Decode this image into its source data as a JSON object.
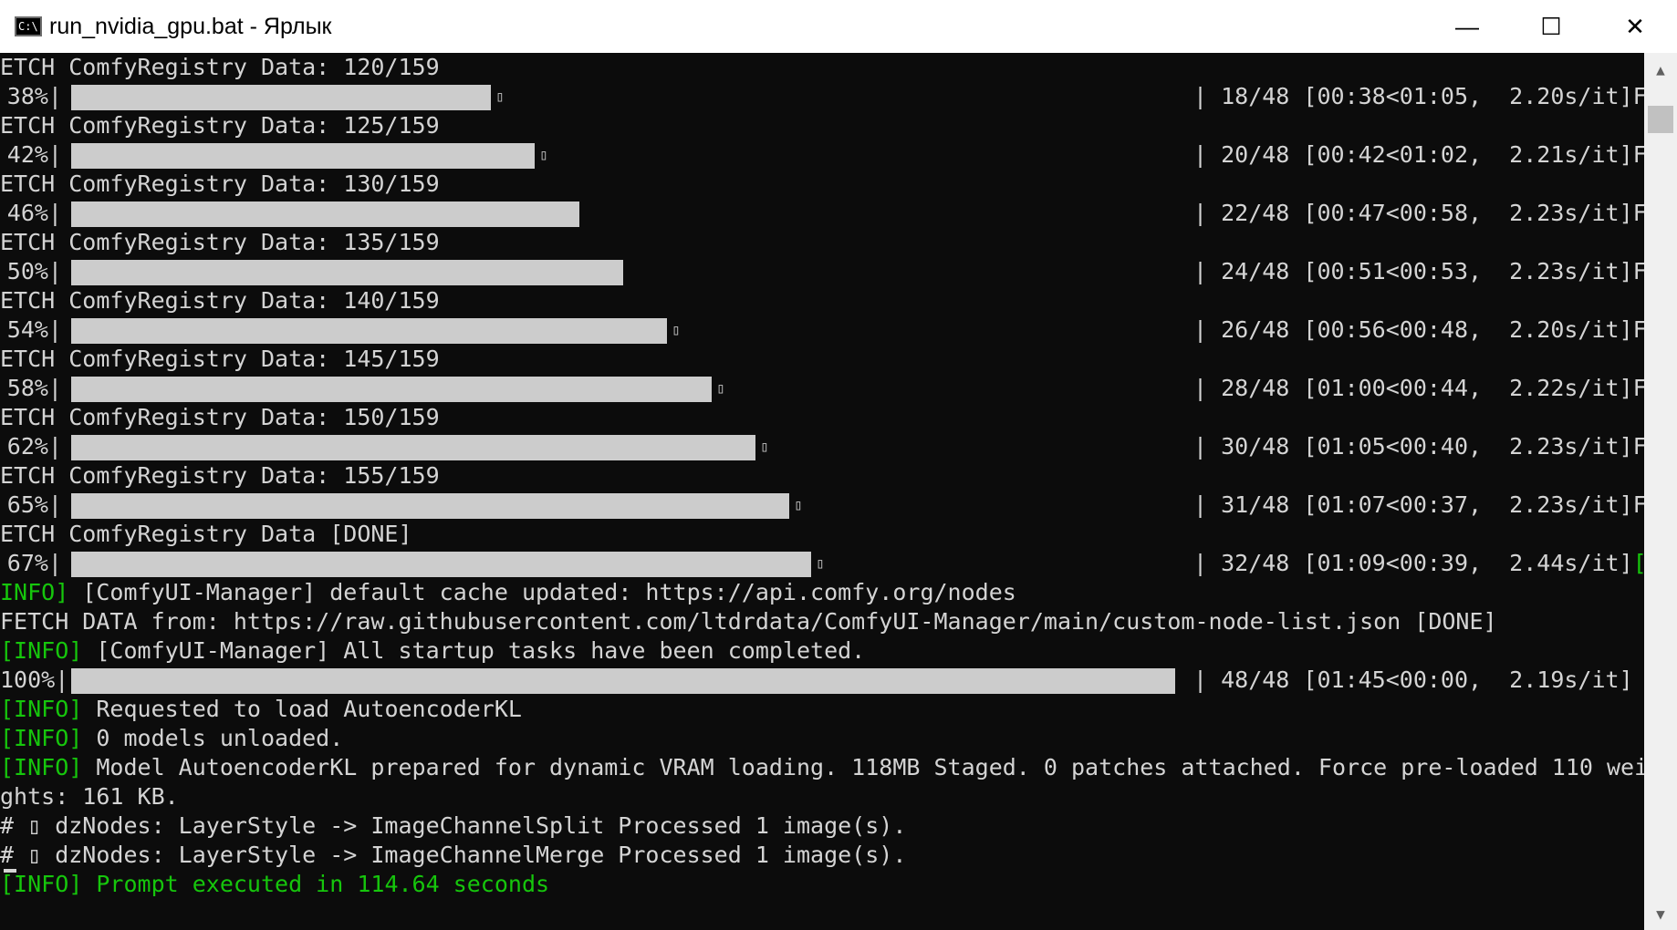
{
  "window": {
    "title": "run_nvidia_gpu.bat - Ярлык",
    "icon_name": "cmd-console-icon",
    "icon_label": "C:\\",
    "controls": {
      "minimize": "—",
      "maximize": "☐",
      "close": "✕"
    }
  },
  "console": {
    "colors": {
      "background": "#0c0c0c",
      "text": "#d4d4d4",
      "green": "#16c60c",
      "bar": "#cccccc"
    },
    "lines": [
      {
        "type": "text",
        "text": "ETCH ComfyRegistry Data: 120/159"
      },
      {
        "type": "bar",
        "percent_label": "38%|",
        "progress": 0.38,
        "glyph": "▯",
        "tail": "| 18/48 [00:38<01:05,  2.20s/it]F"
      },
      {
        "type": "text",
        "text": "ETCH ComfyRegistry Data: 125/159"
      },
      {
        "type": "bar",
        "percent_label": "42%|",
        "progress": 0.42,
        "glyph": "▯",
        "tail": "| 20/48 [00:42<01:02,  2.21s/it]F"
      },
      {
        "type": "text",
        "text": "ETCH ComfyRegistry Data: 130/159"
      },
      {
        "type": "bar",
        "percent_label": "46%|",
        "progress": 0.46,
        "glyph": "",
        "tail": "| 22/48 [00:47<00:58,  2.23s/it]F"
      },
      {
        "type": "text",
        "text": "ETCH ComfyRegistry Data: 135/159"
      },
      {
        "type": "bar",
        "percent_label": "50%|",
        "progress": 0.5,
        "glyph": "",
        "tail": "| 24/48 [00:51<00:53,  2.23s/it]F"
      },
      {
        "type": "text",
        "text": "ETCH ComfyRegistry Data: 140/159"
      },
      {
        "type": "bar",
        "percent_label": "54%|",
        "progress": 0.54,
        "glyph": "▯",
        "tail": "| 26/48 [00:56<00:48,  2.20s/it]F"
      },
      {
        "type": "text",
        "text": "ETCH ComfyRegistry Data: 145/159"
      },
      {
        "type": "bar",
        "percent_label": "58%|",
        "progress": 0.58,
        "glyph": "▯",
        "tail": "| 28/48 [01:00<00:44,  2.22s/it]F"
      },
      {
        "type": "text",
        "text": "ETCH ComfyRegistry Data: 150/159"
      },
      {
        "type": "bar",
        "percent_label": "62%|",
        "progress": 0.62,
        "glyph": "▯",
        "tail": "| 30/48 [01:05<00:40,  2.23s/it]F"
      },
      {
        "type": "text",
        "text": "ETCH ComfyRegistry Data: 155/159"
      },
      {
        "type": "bar",
        "percent_label": "65%|",
        "progress": 0.65,
        "glyph": "▯",
        "tail": "| 31/48 [01:07<00:37,  2.23s/it]F"
      },
      {
        "type": "text",
        "text": "ETCH ComfyRegistry Data [DONE]"
      },
      {
        "type": "bar",
        "percent_label": "67%|",
        "progress": 0.67,
        "glyph": "▯",
        "tail": "| 32/48 [01:09<00:39,  2.44s/it]",
        "tail_green": "["
      },
      {
        "type": "text",
        "prefix": "INFO]",
        "text": " [ComfyUI-Manager] default cache updated: https://api.comfy.org/nodes"
      },
      {
        "type": "text",
        "text": "FETCH DATA from: https://raw.githubusercontent.com/ltdrdata/ComfyUI-Manager/main/custom-node-list.json [DONE]"
      },
      {
        "type": "text",
        "prefix": "[INFO]",
        "text": " [ComfyUI-Manager] All startup tasks have been completed."
      },
      {
        "type": "bar",
        "percent_label": "100%|",
        "progress": 1.0,
        "glyph": "",
        "tail": "| 48/48 [01:45<00:00,  2.19s/it]"
      },
      {
        "type": "text",
        "prefix": "[INFO]",
        "text": " Requested to load AutoencoderKL"
      },
      {
        "type": "text",
        "prefix": "[INFO]",
        "text": " 0 models unloaded."
      },
      {
        "type": "text",
        "prefix": "[INFO]",
        "text": " Model AutoencoderKL prepared for dynamic VRAM loading. 118MB Staged. 0 patches attached. Force pre-loaded 110 wei"
      },
      {
        "type": "text",
        "text": "ghts: 161 KB."
      },
      {
        "type": "text",
        "text": "# ▯ dzNodes: LayerStyle -> ImageChannelSplit Processed 1 image(s)."
      },
      {
        "type": "text",
        "text": "# ▯ dzNodes: LayerStyle -> ImageChannelMerge Processed 1 image(s)."
      },
      {
        "type": "text",
        "prefix": "[INFO]",
        "text": " Prompt executed in 114.64 seconds",
        "all_green": true
      }
    ]
  },
  "scrollbar": {
    "up": "▲",
    "down": "▼",
    "thumb_position": 0.02
  }
}
